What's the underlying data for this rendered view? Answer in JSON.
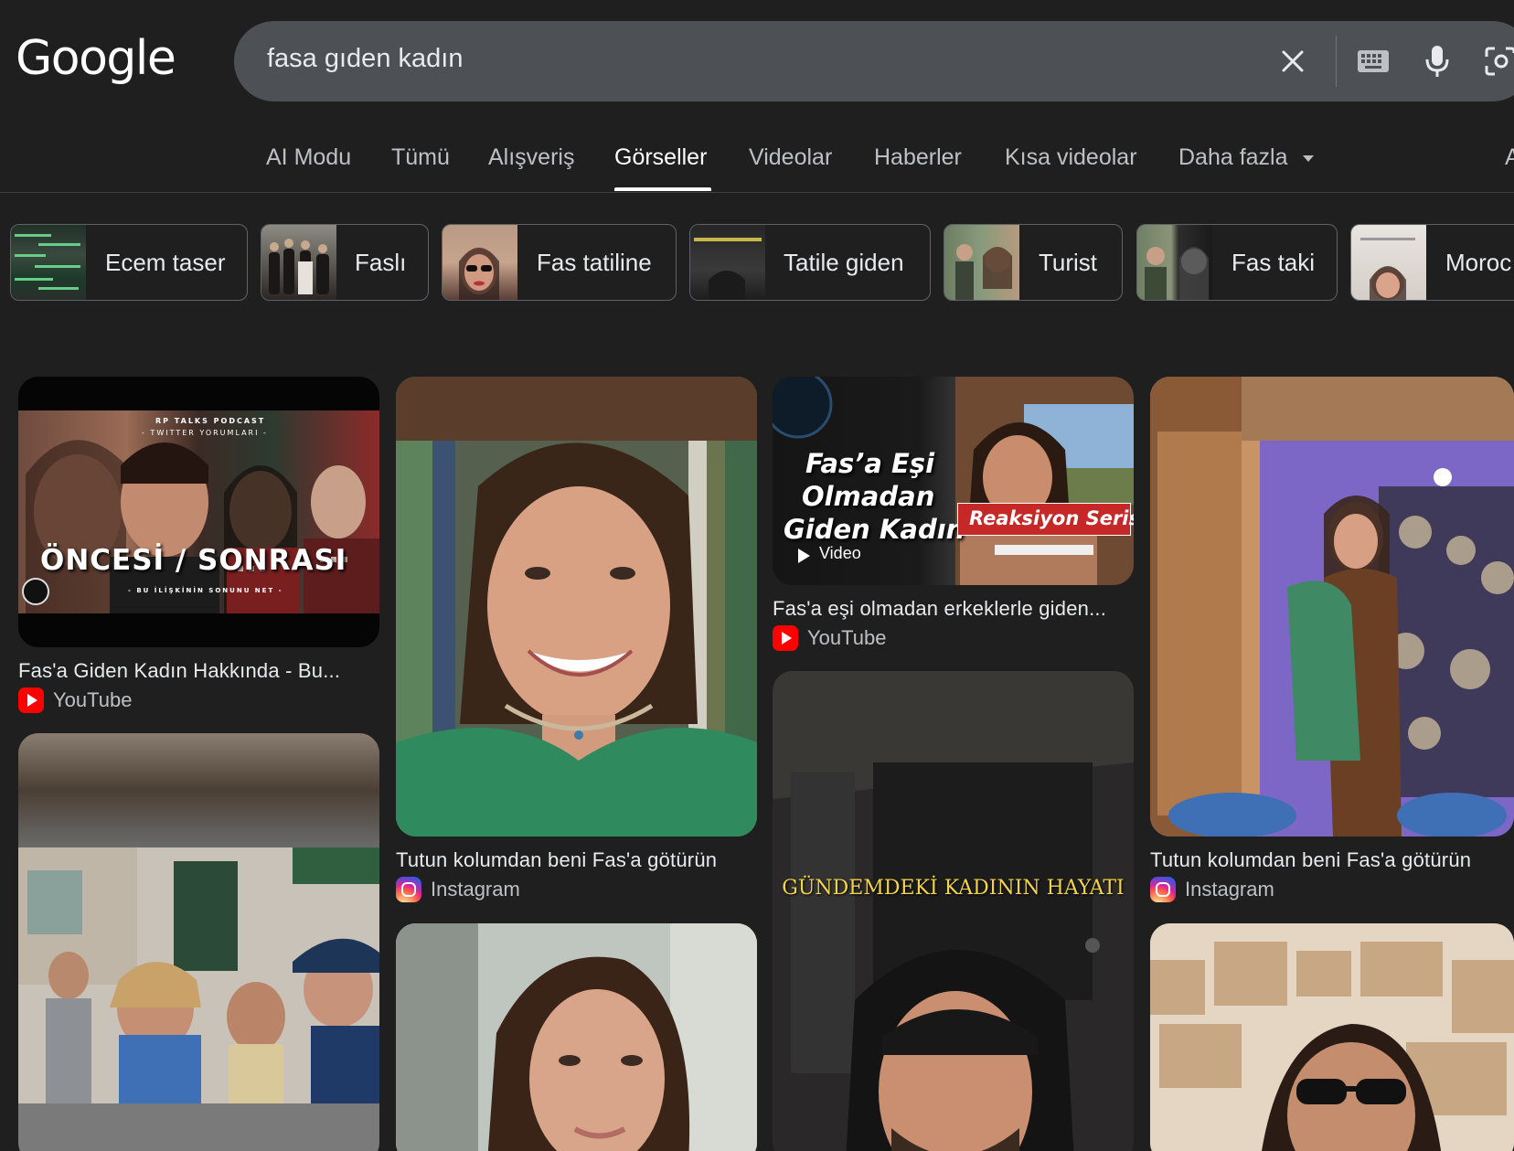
{
  "header": {
    "logo": "Google",
    "search_value": "fasa gıden kadın"
  },
  "icons": {
    "clear": "close-icon",
    "keyboard": "keyboard-icon",
    "mic": "microphone-icon",
    "lens": "camera-lens-icon"
  },
  "tabs": [
    {
      "label": "AI Modu"
    },
    {
      "label": "Tümü"
    },
    {
      "label": "Alışveriş"
    },
    {
      "label": "Görseller",
      "active": true
    },
    {
      "label": "Videolar"
    },
    {
      "label": "Haberler"
    },
    {
      "label": "Kısa videolar"
    },
    {
      "label": "Daha fazla"
    },
    {
      "label": "A"
    }
  ],
  "chips": [
    {
      "label": "Ecem taser"
    },
    {
      "label": "Faslı"
    },
    {
      "label": "Fas tatiline"
    },
    {
      "label": "Tatile giden"
    },
    {
      "label": "Turist"
    },
    {
      "label": "Fas taki"
    },
    {
      "label": "Moroc"
    }
  ],
  "results": [
    {
      "title": "Fas'a Giden Kadın Hakkında - Bu...",
      "source": "YouTube",
      "overlay_main": "ÖNCESİ / SONRASI",
      "overlay_top": "RP TALKS PODCAST",
      "overlay_sub": "- TWITTER YORUMLARI -",
      "overlay_bottom": "- BU İLİŞKİNİN SONUNU NET -"
    },
    {
      "title": "Tutun kolumdan beni Fas'a götürün",
      "source": "Instagram"
    },
    {
      "title": "Fas'a eşi olmadan erkeklerle giden...",
      "source": "YouTube",
      "overlay_lines": [
        "Fas’a Eşi",
        "Olmadan",
        "Giden Kadın"
      ],
      "overlay_tag": "Reaksiyon Serisi",
      "video_label": "Video"
    },
    {
      "title": "Tutun kolumdan beni Fas'a götürün",
      "source": "Instagram"
    },
    {
      "overlay_caption": "GÜNDEMDEKİ KADININ HAYATI"
    }
  ],
  "colors": {
    "background": "#1f1f1f",
    "searchbar": "#4d5156",
    "youtube_red": "#ff0000",
    "tag_red": "#c62828"
  }
}
